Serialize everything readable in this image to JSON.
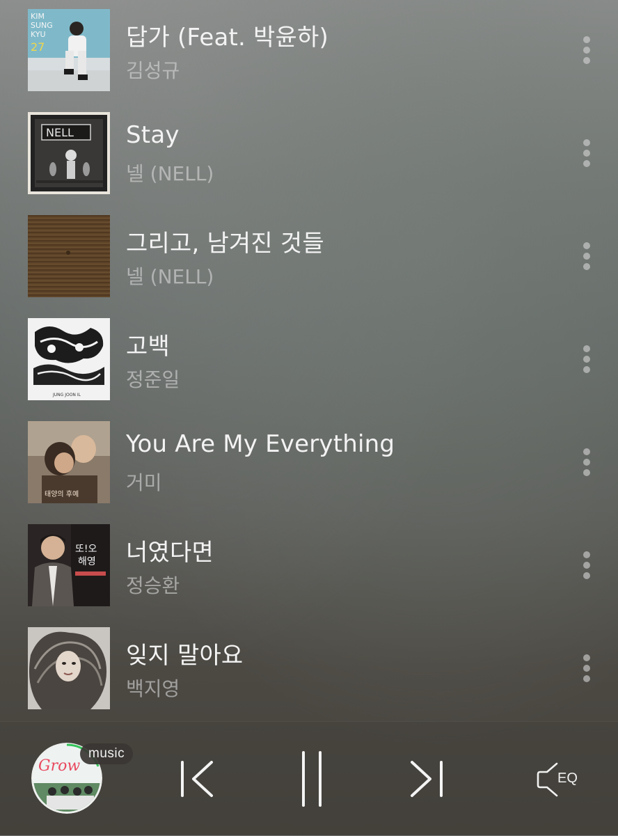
{
  "playlist": {
    "tracks": [
      {
        "title": "답가 (Feat. 박윤하)",
        "artist": "김성규",
        "cover_icon": "album-cover-kim-sung-kyu",
        "cover_text": "KIM SUNG KYU 27"
      },
      {
        "title": "Stay",
        "artist": "넬 (NELL)",
        "cover_icon": "album-cover-nell-stay",
        "cover_text": "NELL"
      },
      {
        "title": "그리고, 남겨진 것들",
        "artist": "넬 (NELL)",
        "cover_icon": "album-cover-nell-wood",
        "cover_text": ""
      },
      {
        "title": "고백",
        "artist": "정준일",
        "cover_icon": "album-cover-illustration",
        "cover_text": "JUNG JOON IL"
      },
      {
        "title": "You Are My Everything",
        "artist": "거미",
        "cover_icon": "album-cover-couple",
        "cover_text": ""
      },
      {
        "title": "너였다면",
        "artist": "정승환",
        "cover_icon": "album-cover-man-suit",
        "cover_text": "또!오해영"
      },
      {
        "title": "잊지 말아요",
        "artist": "백지영",
        "cover_icon": "album-cover-woman-hair",
        "cover_text": ""
      }
    ]
  },
  "player": {
    "badge_label": "music",
    "now_playing_cover_text": "Grow",
    "eq_label": "EQ",
    "state": "playing",
    "icons": {
      "previous": "skip-previous-icon",
      "pause": "pause-icon",
      "next": "skip-next-icon",
      "eq": "speaker-eq-icon",
      "more": "more-vertical-icon"
    }
  },
  "colors": {
    "title": "#f3f3f3",
    "artist": "#d7d7d7",
    "badge_bg": "#3a3633",
    "disc_ring_accent": "#35c45a"
  }
}
